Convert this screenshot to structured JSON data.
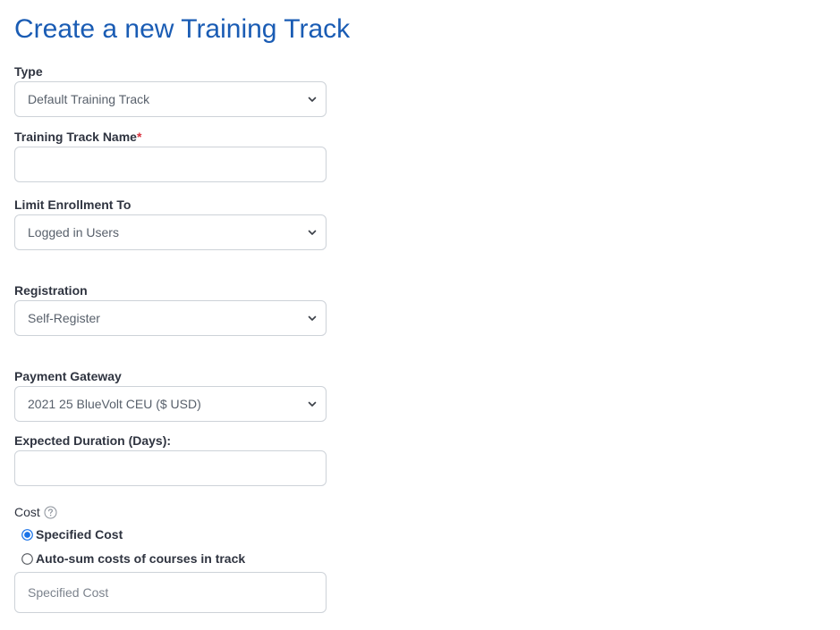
{
  "page": {
    "title": "Create a new Training Track"
  },
  "type": {
    "label": "Type",
    "selected": "Default Training Track"
  },
  "name": {
    "label": "Training Track Name",
    "required_mark": "*",
    "value": ""
  },
  "limit_enrollment": {
    "label": "Limit Enrollment To",
    "selected": "Logged in Users"
  },
  "registration": {
    "label": "Registration",
    "selected": "Self-Register"
  },
  "payment_gateway": {
    "label": "Payment Gateway",
    "selected": "2021 25 BlueVolt CEU ($ USD)"
  },
  "duration": {
    "label": "Expected Duration (Days):",
    "value": ""
  },
  "cost": {
    "label": "Cost",
    "help_icon": "question-circle-icon",
    "options": [
      {
        "label": "Specified Cost",
        "checked": true
      },
      {
        "label": "Auto-sum costs of courses in track",
        "checked": false
      }
    ],
    "specified_cost_placeholder": "Specified Cost"
  },
  "colors": {
    "title": "#1a5cb4",
    "required": "#d9333f",
    "radio_selected": "#1a73e8",
    "border": "#cdd2d8"
  }
}
